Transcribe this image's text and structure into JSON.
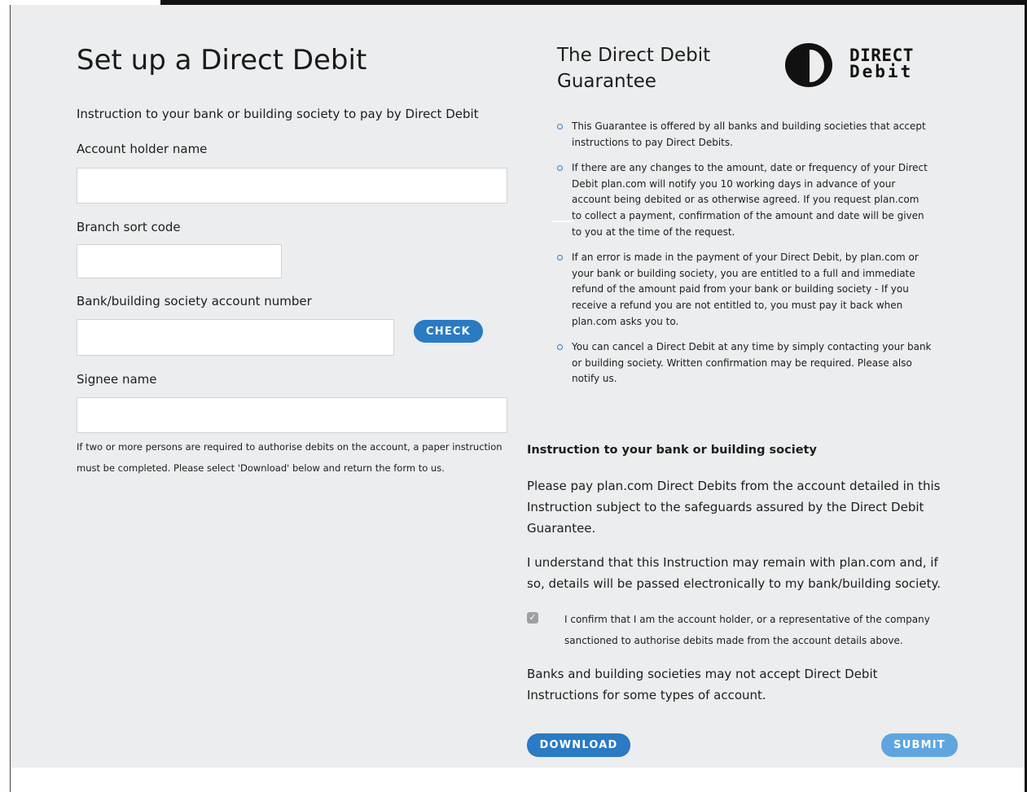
{
  "form": {
    "title": "Set up a Direct Debit",
    "intro": "Instruction to your bank or building society to pay by Direct Debit",
    "fields": {
      "account_holder": {
        "label": "Account holder name",
        "value": ""
      },
      "sort_code": {
        "label": "Branch sort code",
        "value": ""
      },
      "account_number": {
        "label": "Bank/building society account number",
        "value": ""
      },
      "signee": {
        "label": "Signee name",
        "value": ""
      }
    },
    "check_label": "CHECK",
    "note": "If two or more persons are required to authorise debits on the account, a paper instruction must be completed. Please select 'Download' below and return the form to us."
  },
  "guarantee": {
    "title": "The Direct Debit Guarantee",
    "logo": {
      "line1": "DIRECT",
      "line2": "Debit",
      "icon": "direct-debit-logo"
    },
    "items": [
      "This Guarantee is offered by all banks and building societies that accept instructions to pay Direct Debits.",
      "If there are any changes to the amount, date or frequency of your Direct Debit plan.com will notify you 10 working days in advance of your account being debited or as otherwise agreed. If you request plan.com to collect a payment, confirmation of the amount and date will be given to you at the time of the request.",
      "If an error is made in the payment of your Direct Debit, by plan.com or your bank or building society, you are entitled to a full and immediate refund of the amount paid from your bank or building society - If you receive a refund you are not entitled to, you must pay it back when plan.com asks you to.",
      "You can cancel a Direct Debit at any time by simply contacting your bank or building society. Written confirmation may be required. Please also notify us."
    ]
  },
  "instruction": {
    "heading": "Instruction to your bank or building society",
    "para1": "Please pay plan.com Direct Debits from the account detailed in this Instruction subject to the safeguards assured by the Direct Debit Guarantee.",
    "para2": "I understand that this Instruction may remain with plan.com and, if so, details will be passed electronically to my bank/building society.",
    "confirm_checked": true,
    "confirm": "I confirm that I am the account holder, or a representative of the company sanctioned to authorise debits made from the account details above.",
    "para3": "Banks and building societies may not accept Direct Debit Instructions for some types of account."
  },
  "actions": {
    "download": "DOWNLOAD",
    "submit": "SUBMIT"
  },
  "colors": {
    "panel": "#ecedee",
    "primary_button": "#2a7ac4",
    "submit_button": "#5fa6e0",
    "bullet": "#2f7fc8"
  }
}
